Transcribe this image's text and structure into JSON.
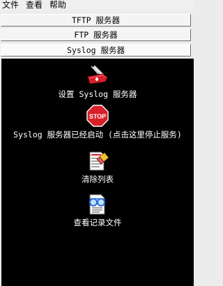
{
  "menu": {
    "items": [
      "文件",
      "查看",
      "帮助"
    ]
  },
  "tabs": [
    {
      "label": "TFTP 服务器"
    },
    {
      "label": "FTP 服务器"
    },
    {
      "label": "Syslog 服务器"
    }
  ],
  "actions": {
    "settings": {
      "label": "设置 Syslog 服务器",
      "icon": "pocketknife-icon"
    },
    "status": {
      "label": "Syslog 服务器已经启动 (点击这里停止服务)",
      "icon": "stop-sign-icon",
      "stop_text": "STOP"
    },
    "clear": {
      "label": "清除列表",
      "icon": "eraser-document-icon"
    },
    "log": {
      "label": "查看记录文件",
      "icon": "view-log-file-icon"
    }
  },
  "colors": {
    "panel": "#000000",
    "stop_red": "#d8202a",
    "accent_blue": "#2a6fd6"
  }
}
